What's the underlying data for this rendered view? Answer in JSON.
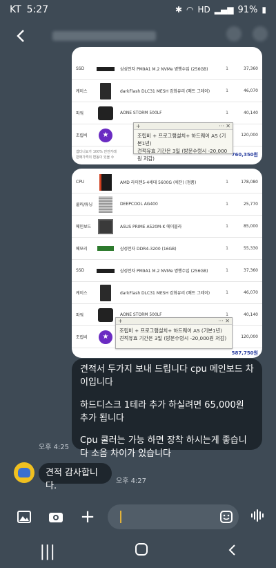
{
  "status": {
    "carrier": "KT",
    "time": "5:27",
    "battery": "91%",
    "hd": "HD"
  },
  "card1": {
    "rows": [
      {
        "cat": "SSD",
        "name": "삼성전자 PM9A1 M.2 NVMe 병행수입 (256GB)",
        "qty": "1",
        "price": "37,360",
        "thumb": "ssd"
      },
      {
        "cat": "케이스",
        "name": "darkFlash DLC31 MESH 강화유리 (매트 그레이)",
        "qty": "1",
        "price": "46,070",
        "thumb": "case"
      },
      {
        "cat": "파워",
        "name": "AONE STORM 500LF",
        "qty": "1",
        "price": "40,140",
        "thumb": "psu"
      },
      {
        "cat": "조립비",
        "name": "",
        "qty": "",
        "price": "120,000",
        "thumb": "star"
      }
    ],
    "footer_note_1": "셉다니요가 100% 안전거래",
    "footer_note_2": "판매가격의 변동이 있을 수",
    "total": "760,350원"
  },
  "memo1": {
    "line1": "조립비 + 프로그램설치+ 하드웨어 AS (기본1년)",
    "line2": "견적유효 기간은 3일 (방문수령시 -20,000원 저감)"
  },
  "card2": {
    "rows": [
      {
        "cat": "CPU",
        "name": "AMD 라이젠5-4세대 5600G (세잔) (정품)",
        "qty": "1",
        "price": "178,080",
        "thumb": "cpu"
      },
      {
        "cat": "쿨러/튜닝",
        "name": "DEEPCOOL AG400",
        "qty": "1",
        "price": "25,770",
        "thumb": "cool"
      },
      {
        "cat": "메인보드",
        "name": "ASUS PRIME A520M-K 에이블라",
        "qty": "1",
        "price": "85,000",
        "thumb": "mb"
      },
      {
        "cat": "메모리",
        "name": "삼성전자 DDR4-3200 (16GB)",
        "qty": "1",
        "price": "55,330",
        "thumb": "ram"
      },
      {
        "cat": "SSD",
        "name": "삼성전자 PM9A1 M.2 NVMe 병행수입 (256GB)",
        "qty": "1",
        "price": "37,360",
        "thumb": "ssd"
      },
      {
        "cat": "케이스",
        "name": "darkFlash DLC31 MESH 강화유리 (매트 그레이)",
        "qty": "1",
        "price": "46,070",
        "thumb": "case"
      },
      {
        "cat": "파워",
        "name": "AONE STORM 500LF",
        "qty": "1",
        "price": "40,140",
        "thumb": "psu"
      },
      {
        "cat": "조립비",
        "name": "",
        "qty": "",
        "price": "120,000",
        "thumb": "star"
      }
    ],
    "total": "587,750원"
  },
  "memo2": {
    "line1": "조립비 + 프로그램설치+ 하드웨어 AS (기본1년)",
    "line2": "견적유효 기간은 3일 (방문수령시 -20,000원 저감)"
  },
  "msg1": {
    "p1": "견적서 두가지 보내 드립니다 cpu 메인보드 차이입니다",
    "p2": "하드디스크 1테라 추가 하실려면 65,000원 추가 됩니다",
    "p3": "Cpu 쿨러는 가능 하면 장착 하시는게 좋습니다 소음 차이가 있습니다",
    "time": "오후 4:25"
  },
  "msg2": {
    "text": "견적 감사합니다.",
    "time": "오후 4:27"
  },
  "input": {
    "placeholder": ""
  }
}
